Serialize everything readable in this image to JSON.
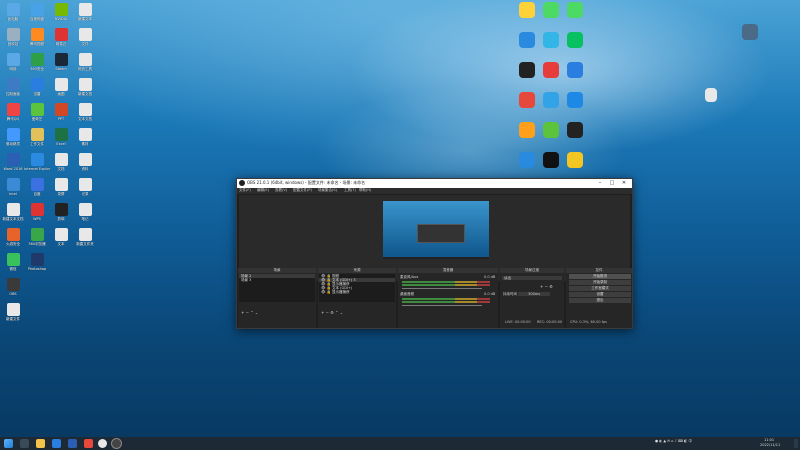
{
  "desktop_icons_left": [
    {
      "label": "此电脑",
      "color": "#5aa8e6",
      "col": 0,
      "row": 0
    },
    {
      "label": "回收站",
      "color": "#9ab0c0",
      "col": 0,
      "row": 1
    },
    {
      "label": "网络",
      "color": "#5aa8e6",
      "col": 0,
      "row": 2
    },
    {
      "label": "控制面板",
      "color": "#3d7cc4",
      "col": 0,
      "row": 3
    },
    {
      "label": "腾讯QQ",
      "color": "#e44",
      "col": 0,
      "row": 4
    },
    {
      "label": "驱动精灵",
      "color": "#49f",
      "col": 0,
      "row": 5
    },
    {
      "label": "Word 2016",
      "color": "#2b5fb4",
      "col": 0,
      "row": 6
    },
    {
      "label": "Intel",
      "color": "#3a8ad6",
      "col": 0,
      "row": 7
    },
    {
      "label": "新建文本文档",
      "color": "#e8e8e8",
      "col": 0,
      "row": 8
    },
    {
      "label": "火绒安全",
      "color": "#e6642a",
      "col": 0,
      "row": 9
    },
    {
      "label": "微信",
      "color": "#39c25b",
      "col": 0,
      "row": 10
    },
    {
      "label": "OBS",
      "color": "#3a3a3a",
      "col": 0,
      "row": 11
    },
    {
      "label": "新建文件",
      "color": "#e8e8e8",
      "col": 0,
      "row": 12
    },
    {
      "label": "百度网盘",
      "color": "#4aa2e6",
      "col": 1,
      "row": 0
    },
    {
      "label": "腾讯视频",
      "color": "#ff8a1f",
      "col": 1,
      "row": 1
    },
    {
      "label": "360安全",
      "color": "#2e9e48",
      "col": 1,
      "row": 2
    },
    {
      "label": "迅雷",
      "color": "#2a7ee0",
      "col": 1,
      "row": 3
    },
    {
      "label": "爱奇艺",
      "color": "#5cc43c",
      "col": 1,
      "row": 4
    },
    {
      "label": "工作文件",
      "color": "#e2c05a",
      "col": 1,
      "row": 5
    },
    {
      "label": "Internet Explorer",
      "color": "#2a8ae0",
      "col": 1,
      "row": 6
    },
    {
      "label": "百度",
      "color": "#3a70e0",
      "col": 1,
      "row": 7
    },
    {
      "label": "WPS",
      "color": "#d33",
      "col": 1,
      "row": 8
    },
    {
      "label": "360浏览器",
      "color": "#3aa64a",
      "col": 1,
      "row": 9
    },
    {
      "label": "Photoshop",
      "color": "#1f3a6a",
      "col": 1,
      "row": 10
    },
    {
      "label": "NVIDIA",
      "color": "#77b900",
      "col": 2,
      "row": 0
    },
    {
      "label": "网易云",
      "color": "#d33",
      "col": 2,
      "row": 1
    },
    {
      "label": "Steam",
      "color": "#1b2838",
      "col": 2,
      "row": 2
    },
    {
      "label": "画图",
      "color": "#e8e8e8",
      "col": 2,
      "row": 3
    },
    {
      "label": "PPT",
      "color": "#d24726",
      "col": 2,
      "row": 4
    },
    {
      "label": "Excel",
      "color": "#1e7145",
      "col": 2,
      "row": 5
    },
    {
      "label": "文档",
      "color": "#e8e8e8",
      "col": 2,
      "row": 6
    },
    {
      "label": "录屏",
      "color": "#e8e8e8",
      "col": 2,
      "row": 7
    },
    {
      "label": "剪映",
      "color": "#222",
      "col": 2,
      "row": 8
    },
    {
      "label": "文本",
      "color": "#e8e8e8",
      "col": 2,
      "row": 9
    },
    {
      "label": "新建文本",
      "color": "#e8e8e8",
      "col": 3,
      "row": 0
    },
    {
      "label": "文件",
      "color": "#e8e8e8",
      "col": 3,
      "row": 1
    },
    {
      "label": "网页工具",
      "color": "#e8e8e8",
      "col": 3,
      "row": 2
    },
    {
      "label": "新建文档",
      "color": "#e8e8e8",
      "col": 3,
      "row": 3
    },
    {
      "label": "文本文档",
      "color": "#e8e8e8",
      "col": 3,
      "row": 4
    },
    {
      "label": "素材",
      "color": "#e8e8e8",
      "col": 3,
      "row": 5
    },
    {
      "label": "资料",
      "color": "#e8e8e8",
      "col": 3,
      "row": 6
    },
    {
      "label": "记录",
      "color": "#e8e8e8",
      "col": 3,
      "row": 7
    },
    {
      "label": "笔记",
      "color": "#e8e8e8",
      "col": 3,
      "row": 8
    },
    {
      "label": "新建文件夹",
      "color": "#e8e8e8",
      "col": 3,
      "row": 9
    }
  ],
  "desktop_icons_right": [
    {
      "color": "#ffd23a",
      "col": 0,
      "row": 0
    },
    {
      "color": "#4cd964",
      "col": 1,
      "row": 0
    },
    {
      "color": "#4cd964",
      "col": 2,
      "row": 0
    },
    {
      "color": "#2a8ae0",
      "col": 0,
      "row": 1
    },
    {
      "color": "#33b5e5",
      "col": 1,
      "row": 1
    },
    {
      "color": "#07c160",
      "col": 2,
      "row": 1
    },
    {
      "color": "#222",
      "col": 0,
      "row": 2
    },
    {
      "color": "#e63c3c",
      "col": 1,
      "row": 2
    },
    {
      "color": "#2a7ee0",
      "col": 2,
      "row": 2
    },
    {
      "color": "#e6483c",
      "col": 0,
      "row": 3
    },
    {
      "color": "#33a3e8",
      "col": 1,
      "row": 3
    },
    {
      "color": "#1e88e5",
      "col": 2,
      "row": 3
    },
    {
      "color": "#ff9f1a",
      "col": 0,
      "row": 4
    },
    {
      "color": "#5cc43c",
      "col": 1,
      "row": 4
    },
    {
      "color": "#222",
      "col": 2,
      "row": 4
    },
    {
      "color": "#2a8ae0",
      "col": 0,
      "row": 5
    },
    {
      "color": "#111",
      "col": 1,
      "row": 5
    },
    {
      "color": "#f3c623",
      "col": 2,
      "row": 5
    }
  ],
  "obs": {
    "title": "OBS 21.0.1 (64bit, windows) - 配置文件: 未命名 - 场景: 未命名",
    "menu": [
      "文件(F)",
      "编辑(E)",
      "查看(V)",
      "配置文件(P)",
      "场景集合(S)",
      "工具(T)",
      "帮助(H)"
    ],
    "docks": {
      "scenes": {
        "header": "场景",
        "items": [
          "场景 2",
          "场景 3"
        ]
      },
      "sources": {
        "header": "来源",
        "items": [
          "视频",
          "文本 (GDI+) 3",
          "显示器捕获",
          "文本 (GDI+)",
          "显示器捕获"
        ]
      },
      "mixer": {
        "header": "混音器",
        "channels": [
          {
            "name": "麦克风/Aux",
            "db": "0.0 dB"
          },
          {
            "name": "桌面音频",
            "db": "0.0 dB"
          }
        ]
      },
      "transitions": {
        "header": "场景过渡",
        "type": "淡出",
        "duration_label": "持续时间",
        "duration": "300ms"
      },
      "controls": {
        "header": "控件",
        "buttons": [
          "开始推流",
          "开始录制",
          "工作室模式",
          "设置",
          "退出"
        ]
      }
    },
    "status": {
      "live": "LIVE: 00:00:00",
      "rec": "REC: 00:00:00",
      "cpu": "CPU: 0.3%, 60.00 fps"
    }
  },
  "taskbar": {
    "time": "11:01",
    "date": "2022/11/11"
  }
}
